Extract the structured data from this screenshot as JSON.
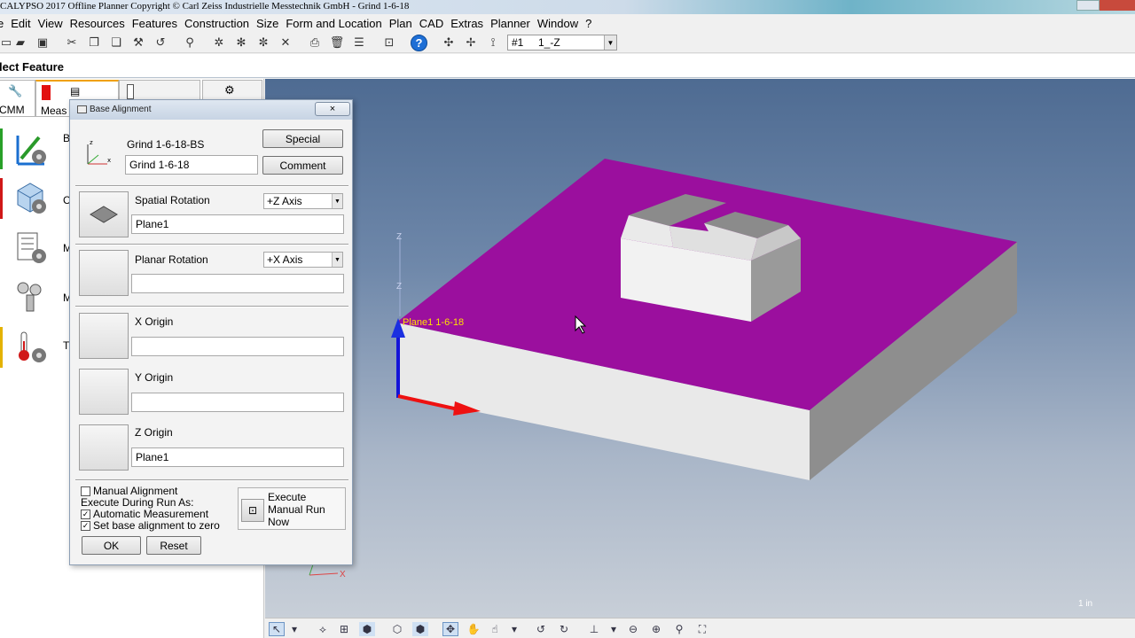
{
  "window": {
    "title": "CALYPSO 2017 Offline Planner Copyright © Carl Zeiss Industrielle Messtechnik GmbH - Grind 1-6-18"
  },
  "menu": [
    "e",
    "Edit",
    "View",
    "Resources",
    "Features",
    "Construction",
    "Size",
    "Form and Location",
    "Plan",
    "CAD",
    "Extras",
    "Planner",
    "Window",
    "?"
  ],
  "toolbar": {
    "plan_combo_number": "#1",
    "plan_combo_value": "1_-Z"
  },
  "panel": {
    "title": "lect Feature",
    "tabs": [
      "CMM",
      "Meas"
    ],
    "side_labels": [
      "B",
      "C",
      "M",
      "M",
      "T"
    ]
  },
  "dialog": {
    "title": "Base Alignment",
    "close_label": "×",
    "alignment_name": "Grind 1-6-18-BS",
    "alignment_field": "Grind 1-6-18",
    "special_label": "Special",
    "comment_label": "Comment",
    "spatial_rotation": {
      "label": "Spatial Rotation",
      "axis": "+Z Axis",
      "feature": "Plane1"
    },
    "planar_rotation": {
      "label": "Planar Rotation",
      "axis": "+X Axis",
      "feature": ""
    },
    "x_origin": {
      "label": "X Origin",
      "feature": ""
    },
    "y_origin": {
      "label": "Y Origin",
      "feature": ""
    },
    "z_origin": {
      "label": "Z Origin",
      "feature": "Plane1"
    },
    "manual_alignment_label": "Manual Alignment",
    "execute_during_run_label": "Execute During Run As:",
    "automatic_measurement_label": "Automatic Measurement",
    "set_base_zero_label": "Set base alignment to zero",
    "execute_manual_run": [
      "Execute",
      "Manual Run",
      "Now"
    ],
    "ok_label": "OK",
    "reset_label": "Reset"
  },
  "viewport": {
    "axis_z_top": "Z",
    "axis_z_mid": "Z",
    "feature_label": "Plane1 1-6-18",
    "small_axis_x": "X",
    "scale_text": "1 in",
    "colors": {
      "top_face": "#9b0f9e",
      "side_face": "#e9e9e9",
      "dark_face": "#8e8e8e",
      "background_top": "#4e6b92",
      "background_bottom": "#c8cfd8"
    }
  }
}
